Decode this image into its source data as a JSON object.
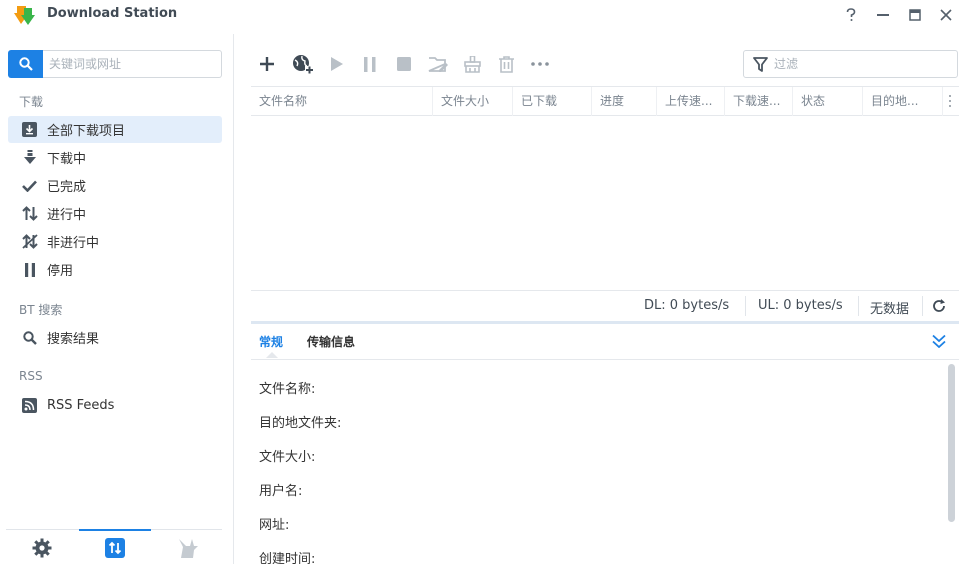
{
  "window": {
    "title": "Download Station",
    "controls": [
      "help-icon",
      "minimize-icon",
      "maximize-icon",
      "close-icon"
    ]
  },
  "sidebar": {
    "search_placeholder": "关键词或网址",
    "sections": {
      "download": "下载",
      "bt_search": "BT 搜索",
      "rss": "RSS"
    },
    "items": [
      {
        "label": "全部下载项目",
        "icon": "download-box-icon",
        "active": true
      },
      {
        "label": "下载中",
        "icon": "arrow-down-icon"
      },
      {
        "label": "已完成",
        "icon": "check-icon"
      },
      {
        "label": "进行中",
        "icon": "up-down-arrows-icon"
      },
      {
        "label": "非进行中",
        "icon": "inactive-icon"
      },
      {
        "label": "停用",
        "icon": "pause-icon"
      },
      {
        "label": "搜索结果",
        "icon": "search-icon"
      },
      {
        "label": "RSS Feeds",
        "icon": "rss-icon"
      }
    ],
    "bottom_tabs": [
      "settings-icon",
      "transfer-icon",
      "emule-icon"
    ]
  },
  "toolbar": {
    "buttons": [
      "add-icon",
      "add-url-icon",
      "resume-icon",
      "pause-icon",
      "stop-icon",
      "edit-destination-icon",
      "clean-up-icon",
      "delete-icon",
      "more-icon"
    ],
    "filter_placeholder": "过滤"
  },
  "grid": {
    "columns": [
      "文件名称",
      "文件大小",
      "已下载",
      "进度",
      "上传速...",
      "下载速...",
      "状态",
      "目的地..."
    ]
  },
  "status": {
    "dl": "DL: 0 bytes/s",
    "ul": "UL: 0 bytes/s",
    "no_data": "无数据"
  },
  "detail": {
    "tabs": [
      "常规",
      "传输信息"
    ],
    "fields": [
      "文件名称:",
      "目的地文件夹:",
      "文件大小:",
      "用户名:",
      "网址:",
      "创建时间:"
    ]
  },
  "colors": {
    "accent": "#1d81e4",
    "active_bg": "#e3eefb",
    "logo_orange": "#f39c12",
    "logo_green": "#39b54a"
  }
}
